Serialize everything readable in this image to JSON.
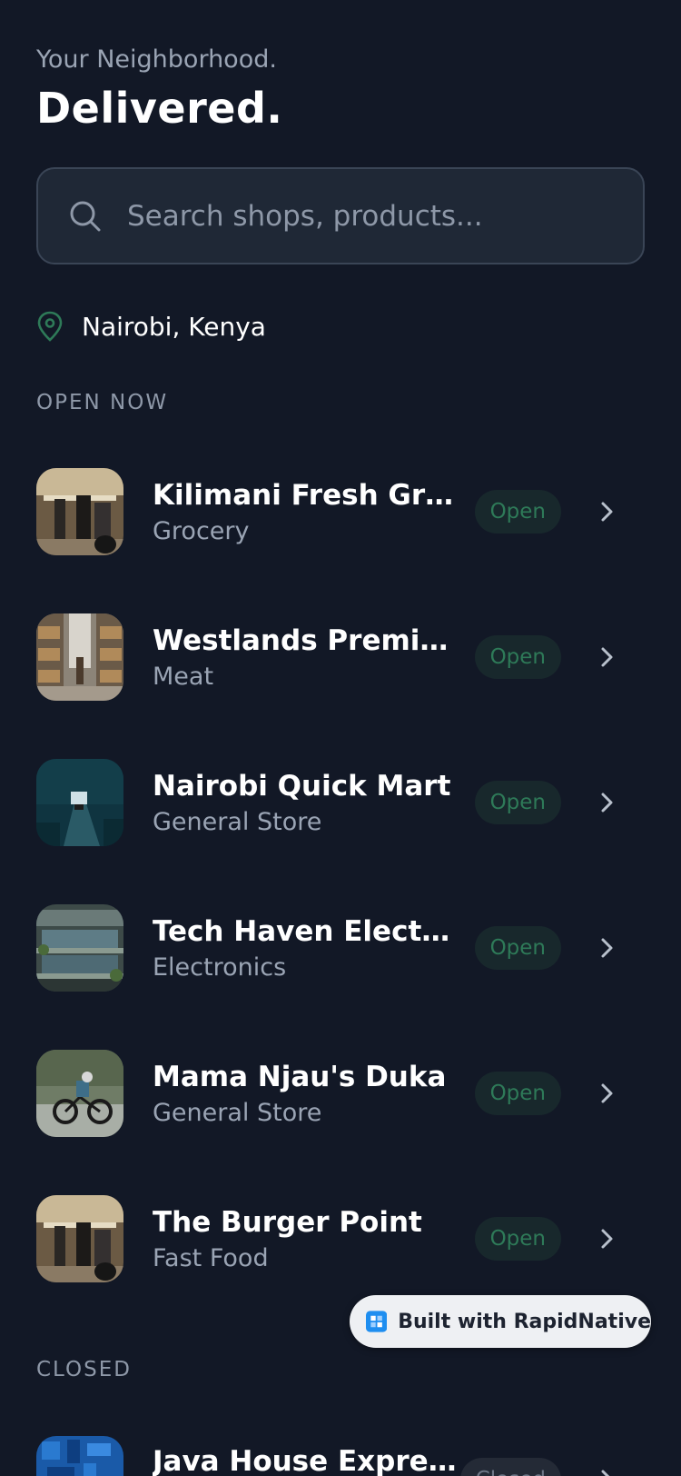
{
  "header": {
    "greeting": "Your Neighborhood.",
    "headline": "Delivered."
  },
  "search": {
    "placeholder": "Search shops, products...",
    "icon": "search-icon"
  },
  "location": {
    "text": "Nairobi, Kenya",
    "icon": "map-pin-icon",
    "icon_color": "#2e7a58"
  },
  "sections": {
    "open_label": "OPEN NOW",
    "closed_label": "CLOSED"
  },
  "open_shops": [
    {
      "name": "Kilimani Fresh Groc...",
      "category": "Grocery",
      "status": "Open",
      "thumb": "store-interior"
    },
    {
      "name": "Westlands Premiu...",
      "category": "Meat",
      "status": "Open",
      "thumb": "warehouse-aisle"
    },
    {
      "name": "Nairobi Quick Mart",
      "category": "General Store",
      "status": "Open",
      "thumb": "forest-road"
    },
    {
      "name": "Tech Haven Electro...",
      "category": "Electronics",
      "status": "Open",
      "thumb": "modern-building"
    },
    {
      "name": "Mama Njau's Duka",
      "category": "General Store",
      "status": "Open",
      "thumb": "cyclist"
    },
    {
      "name": "The Burger Point",
      "category": "Fast Food",
      "status": "Open",
      "thumb": "store-interior"
    }
  ],
  "closed_shops": [
    {
      "name": "Java House Express",
      "status": "Closed",
      "thumb": "blue-pattern"
    }
  ],
  "badge": {
    "label": "Built with RapidNative",
    "icon": "rapidnative-logo-icon"
  },
  "colors": {
    "background": "#121826",
    "open_badge_text": "#2e7a58",
    "open_badge_bg": "#18282c",
    "muted_text": "#9aa4b4"
  }
}
